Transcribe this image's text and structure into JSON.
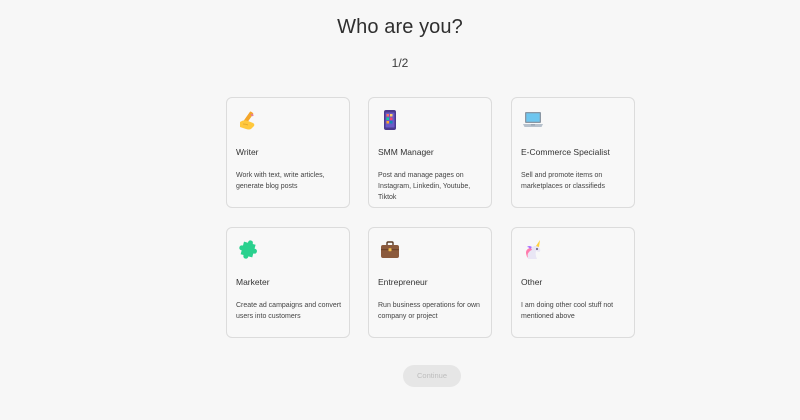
{
  "header": {
    "title": "Who are you?",
    "step": "1/2"
  },
  "roles": [
    {
      "title": "Writer",
      "description": "Work with text, write articles, generate blog posts",
      "icon": "writing-hand-icon"
    },
    {
      "title": "SMM Manager",
      "description": "Post and manage pages on Instagram, Linkedin, Youtube, Tiktok",
      "icon": "mobile-phone-icon"
    },
    {
      "title": "E-Commerce Specialist",
      "description": "Sell and promote items on marketplaces or classifieds",
      "icon": "laptop-icon"
    },
    {
      "title": "Marketer",
      "description": "Create ad campaigns and convert users into customers",
      "icon": "puzzle-icon"
    },
    {
      "title": "Entrepreneur",
      "description": "Run business operations for own company or project",
      "icon": "briefcase-icon"
    },
    {
      "title": "Other",
      "description": "I am doing other cool stuff not mentioned above",
      "icon": "unicorn-icon"
    }
  ],
  "footer": {
    "continue_label": "Continue",
    "continue_disabled": true
  },
  "colors": {
    "background": "#f7f7f7",
    "card_border": "#dcdcdc",
    "button_disabled_bg": "#e6e6e6",
    "button_disabled_text": "#bdbdbd"
  }
}
